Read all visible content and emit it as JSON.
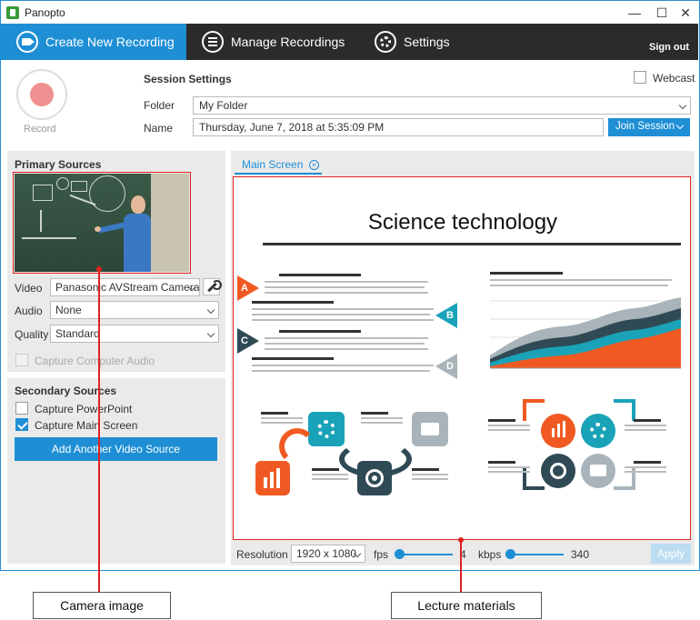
{
  "window": {
    "title": "Panopto",
    "minimize_glyph": "—",
    "maximize_glyph": "☐",
    "close_glyph": "✕"
  },
  "nav": {
    "tabs": [
      {
        "label": "Create New Recording",
        "icon": "camera-icon",
        "active": true
      },
      {
        "label": "Manage Recordings",
        "icon": "list-icon",
        "active": false
      },
      {
        "label": "Settings",
        "icon": "gear-icon",
        "active": false
      }
    ],
    "sign_out": "Sign out"
  },
  "record": {
    "label": "Record"
  },
  "session": {
    "title": "Session Settings",
    "webcast_label": "Webcast",
    "folder_label": "Folder",
    "folder_value": "My Folder",
    "name_label": "Name",
    "name_value": "Thursday, June 7, 2018 at 5:35:09 PM",
    "join_label": "Join Session"
  },
  "primary": {
    "title": "Primary Sources",
    "video_label": "Video",
    "video_value": "Panasonic AVStream Camera",
    "audio_label": "Audio",
    "audio_value": "None",
    "quality_label": "Quality",
    "quality_value": "Standard",
    "capture_audio_label": "Capture Computer Audio"
  },
  "secondary": {
    "title": "Secondary Sources",
    "capture_ppt_label": "Capture PowerPoint",
    "capture_screen_label": "Capture Main Screen",
    "add_video_label": "Add Another Video Source"
  },
  "main": {
    "tab_label": "Main Screen",
    "tab_close_glyph": "×"
  },
  "slide": {
    "title": "Science technology",
    "markers": [
      "A",
      "B",
      "C",
      "D"
    ],
    "colors": {
      "orange": "#f05a22",
      "teal": "#1aa3b8",
      "dark": "#2f4a55",
      "gray": "#a8b4b9"
    }
  },
  "bottom": {
    "resolution_label": "Resolution",
    "resolution_value": "1920 x 1080",
    "fps_label": "fps",
    "fps_value": "4",
    "kbps_label": "kbps",
    "kbps_value": "340",
    "apply_label": "Apply"
  },
  "callouts": {
    "camera": "Camera image",
    "lecture": "Lecture materials"
  },
  "accent": "#1e8fd5",
  "highlight": "#e32020"
}
